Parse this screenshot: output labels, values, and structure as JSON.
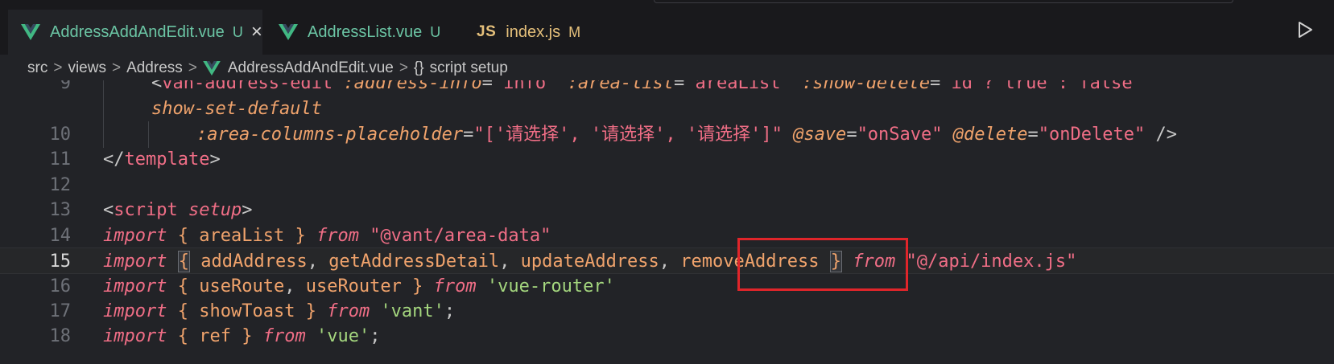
{
  "tabs": [
    {
      "label": "AddressAddAndEdit.vue",
      "badge": "U",
      "icon": "vue-icon",
      "active": true
    },
    {
      "label": "AddressList.vue",
      "badge": "U",
      "icon": "vue-icon",
      "active": false
    },
    {
      "label": "index.js",
      "badge": "M",
      "icon": "js-icon",
      "icon_text": "JS",
      "active": false
    }
  ],
  "breadcrumb": {
    "items": [
      "src",
      "views",
      "Address",
      "AddressAddAndEdit.vue",
      "script setup"
    ],
    "separator": ">",
    "symbol_icon": "{}"
  },
  "editor": {
    "current_line": 15,
    "lines": [
      {
        "num": "9",
        "text": "<van-address-edit :address-info=\"info\" :area-list=\"areaList\" :show-delete=\"id ? true : false\""
      },
      {
        "num": "",
        "text": "show-set-default"
      },
      {
        "num": "10",
        "text": ":area-columns-placeholder=\"['请选择', '请选择', '请选择']\" @save=\"onSave\" @delete=\"onDelete\" />"
      },
      {
        "num": "11",
        "text": "</template>"
      },
      {
        "num": "12",
        "text": ""
      },
      {
        "num": "13",
        "text": "<script setup>"
      },
      {
        "num": "14",
        "text": "import { areaList } from \"@vant/area-data\""
      },
      {
        "num": "15",
        "text": "import { addAddress, getAddressDetail, updateAddress, removeAddress } from \"@/api/index.js\""
      },
      {
        "num": "16",
        "text": "import { useRoute, useRouter } from 'vue-router'"
      },
      {
        "num": "17",
        "text": "import { showToast } from 'vant';"
      },
      {
        "num": "18",
        "text": "import { ref } from 'vue';"
      }
    ]
  },
  "highlight": {
    "target": "removeAddress",
    "color": "#e0252a"
  },
  "colors": {
    "background": "#222327",
    "tabbar": "#19191c",
    "keyword": "#f06e86",
    "identifier": "#f0a36c",
    "string_single": "#a4d67e",
    "vue_green": "#6bc5a4",
    "js_yellow": "#e5c07b"
  },
  "icons": {
    "run": "play-icon",
    "close": "close-icon"
  }
}
